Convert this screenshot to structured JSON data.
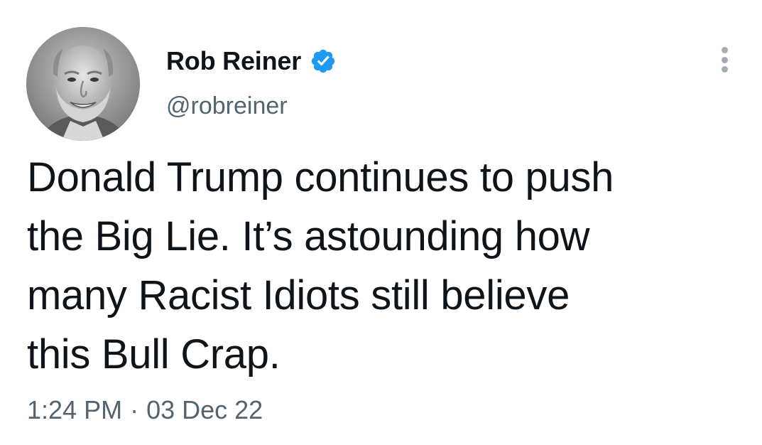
{
  "author": {
    "display_name": "Rob Reiner",
    "handle": "@robreiner",
    "verified": true,
    "avatar_icon": "profile-photo"
  },
  "tweet": {
    "text_lines": [
      "Donald Trump continues to push",
      "the Big Lie. It’s astounding how",
      "many Racist Idiots still believe",
      "this Bull Crap."
    ],
    "time": "1:24 PM",
    "separator": "·",
    "date": "03 Dec 22"
  },
  "icons": {
    "verified": "verified-badge-icon",
    "more": "more-options-icon"
  },
  "colors": {
    "verified_badge": "#1d9bf0",
    "text_primary": "#0f1419",
    "text_secondary": "#536471",
    "more_dots": "#a3adb6"
  }
}
